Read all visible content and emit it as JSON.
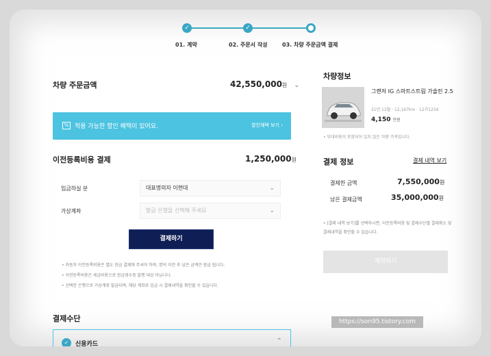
{
  "stepper": {
    "steps": [
      {
        "label": "01. 계약",
        "state": "done"
      },
      {
        "label": "02. 주문서 작성",
        "state": "done"
      },
      {
        "label": "03. 차량 주문금액 결제",
        "state": "current"
      }
    ],
    "check_glyph": "✓"
  },
  "order": {
    "title": "차량 주문금액",
    "amount": "42,550,000",
    "won": "원"
  },
  "discount": {
    "icon_glyph": "%",
    "message": "적용 가능한 할인 혜택이 있어요.",
    "link_label": "할인혜택 보기 ›"
  },
  "transfer": {
    "title": "이전등록비용 결제",
    "amount": "1,250,000",
    "won": "원",
    "payer_label": "입금하실 분",
    "payer_value": "대표명의자 이현대",
    "account_label": "가상계좌",
    "account_placeholder": "발급 은행을 선택해 주세요",
    "pay_button": "결제하기",
    "notes": [
      "자동차 이전등록비용은 별도 현금 결제해 주셔야 하며, 명의 이전 후 남은 금액은 환급 됩니다.",
      "이전등록비용은 세금비용으로 현금영수증 발행 대상 아닙니다.",
      "선택한 은행으로 가상계좌 발급되며, 해당 계좌로 입금 시 결제내역을 확인할 수 있습니다."
    ]
  },
  "payment_method": {
    "title": "결제수단",
    "selected": "신용카드"
  },
  "vehicle": {
    "title": "차량정보",
    "name": "그랜저 IG 스마트스트림 가솔린 2.5",
    "meta": "21년 12월 · 12,167km · 12가1234",
    "price": "4,150",
    "price_unit": "만원",
    "note": "• 부대비용이 포함되어 있지 않은 차량 가격입니다."
  },
  "payment_info": {
    "title": "결제 정보",
    "history_link": "결제 내역 보기",
    "paid_label": "결제한 금액",
    "paid_value": "7,550,000",
    "remaining_label": "남은 결제금액",
    "remaining_value": "35,000,000",
    "won": "원",
    "note": "• [결제 내역 보기]를 선택하시면, 이전등록비용 및 결제수단별 결제취소 및 결제내역을 확인할 수 있습니다.",
    "contract_button": "계약하기"
  },
  "watermark": "https://son95.tistory.com",
  "colors": {
    "accent": "#3aa7c4",
    "banner": "#4cc3e0",
    "primary_button": "#0f1e55",
    "disabled_button": "#e4e4e4"
  }
}
